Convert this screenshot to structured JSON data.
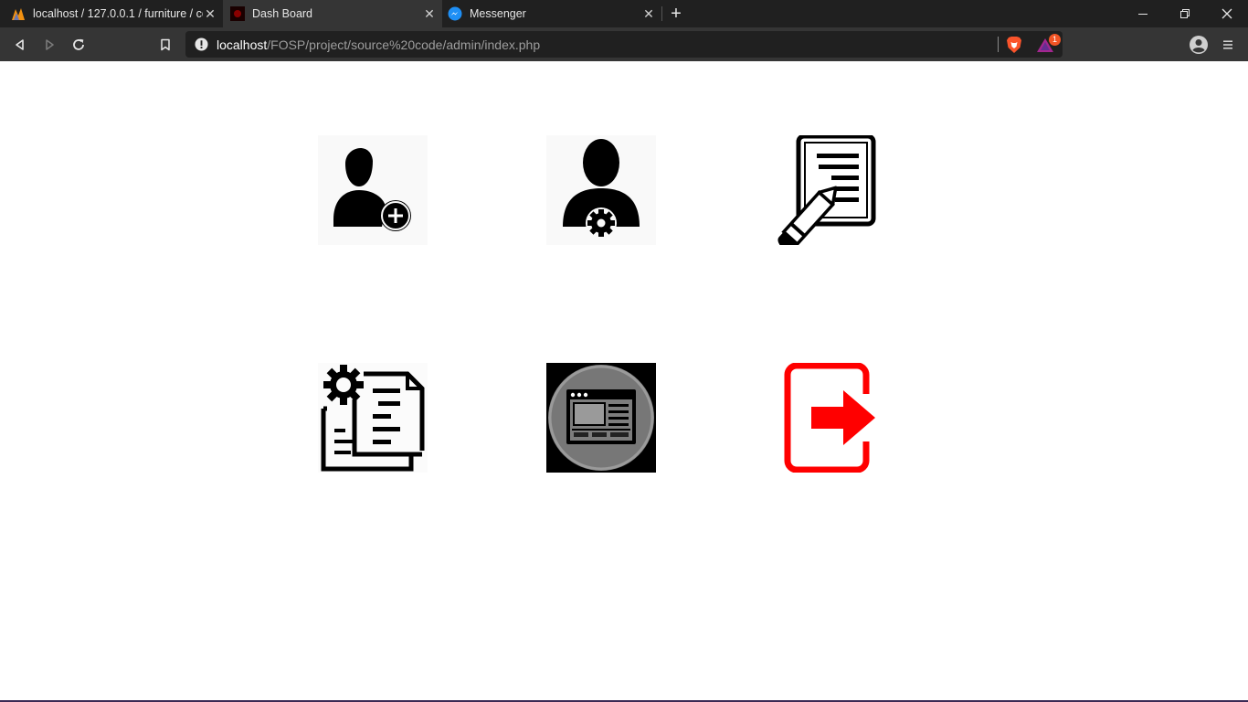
{
  "browser": {
    "tabs": [
      {
        "title": "localhost / 127.0.0.1 / furniture / co",
        "active": false
      },
      {
        "title": "Dash Board",
        "active": true
      },
      {
        "title": "Messenger",
        "active": false
      }
    ],
    "url_host": "localhost",
    "url_path": "/FOSP/project/source%20code/admin/index.php",
    "notification_count": "1",
    "icons": {
      "back": "back-arrow-icon",
      "forward": "forward-arrow-icon",
      "reload": "reload-icon",
      "bookmark": "bookmark-icon",
      "site_info": "info-icon",
      "brave_shields": "brave-lion-icon",
      "rewards": "rewards-triangle-icon",
      "profile": "profile-avatar-icon",
      "menu": "hamburger-menu-icon"
    }
  },
  "dashboard": {
    "tiles": [
      {
        "icon": "add-user-icon"
      },
      {
        "icon": "user-settings-icon"
      },
      {
        "icon": "document-edit-icon"
      },
      {
        "icon": "document-settings-icon"
      },
      {
        "icon": "web-page-icon"
      },
      {
        "icon": "logout-icon"
      }
    ],
    "colors": {
      "icon_black": "#000000",
      "logout_red": "#ff0000",
      "web_icon_bg": "#777777"
    }
  }
}
